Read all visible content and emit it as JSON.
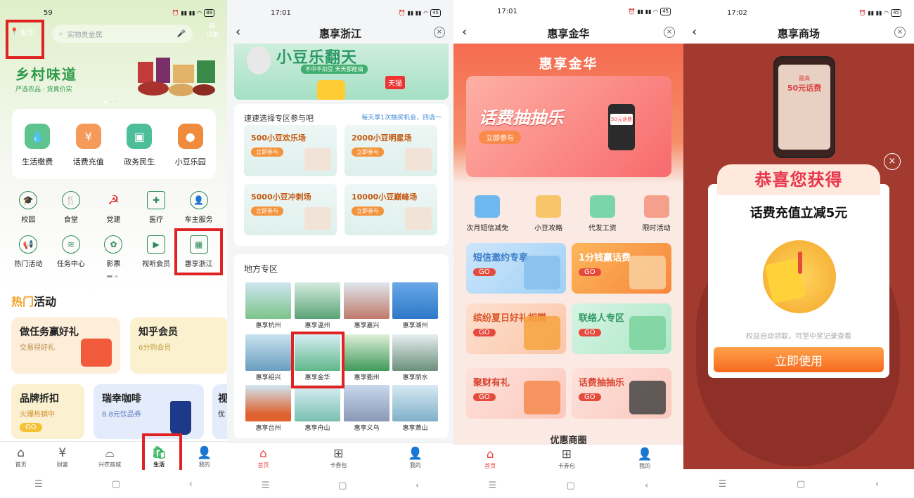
{
  "panel1": {
    "time": "59",
    "battery": "88",
    "location": "金华",
    "search_placeholder": "实物贵金属",
    "orders": "订单",
    "banner_title": "乡村味道",
    "banner_subtitle": "严选农品 · 货真价实",
    "services": [
      "生活缴费",
      "话费充值",
      "政务民生",
      "小豆乐园"
    ],
    "grid": [
      "校园",
      "食堂",
      "党建",
      "医疗",
      "车主服务",
      "热门活动",
      "任务中心",
      "影票",
      "视听会员",
      "惠享浙江"
    ],
    "hot_title_a": "热门",
    "hot_title_b": "活动",
    "cards": [
      {
        "t": "做任务赢好礼",
        "s": "交易得好礼"
      },
      {
        "t": "知乎会员",
        "s": "6分购会员"
      },
      {
        "t": "品牌折扣",
        "s": "火爆热销中",
        "go": "GO"
      },
      {
        "t": "瑞幸咖啡",
        "s": "8.8元饮品券"
      },
      {
        "t": "视",
        "s": "优"
      }
    ],
    "tabs": [
      "首页",
      "财富",
      "兴农商城",
      "生活",
      "我的"
    ]
  },
  "panel2": {
    "time": "17:01",
    "battery": "45",
    "title": "惠享浙江",
    "banner_title": "小豆乐翻天",
    "banner_sub": "不中不扣豆 天天都能抽",
    "banner_tag": "天猫",
    "select_title": "速速选择专区参与吧",
    "select_tip": "每天享1次抽奖机会，四选一",
    "zones": [
      {
        "t": "500小豆欢乐场",
        "b": "立即参与"
      },
      {
        "t": "2000小豆明星场",
        "b": "立即参与"
      },
      {
        "t": "5000小豆冲刺场",
        "b": "立即参与"
      },
      {
        "t": "10000小豆巅峰场",
        "b": "立即参与"
      }
    ],
    "local_title": "地方专区",
    "cities": [
      "惠享杭州",
      "惠享温州",
      "惠享嘉兴",
      "惠享湖州",
      "惠享绍兴",
      "惠享金华",
      "惠享衢州",
      "惠享丽水",
      "惠享台州",
      "惠享舟山",
      "惠享义乌",
      "惠享萧山"
    ],
    "tabs": [
      "首页",
      "卡券包",
      "我的"
    ]
  },
  "panel3": {
    "time": "17:01",
    "battery": "45",
    "title": "惠享金华",
    "header": "惠享金华",
    "card_title": "话费抽抽乐",
    "card_btn": "立即参与",
    "card_phone": "50元话费",
    "icons": [
      "次月短信减免",
      "小豆攻略",
      "代发工资",
      "限时活动"
    ],
    "tiles": [
      {
        "t": "短信邀约专享",
        "g": "GO"
      },
      {
        "t": "1分钱赢话费",
        "g": "GO"
      },
      {
        "t": "缤纷夏日好礼相赠",
        "g": "GO"
      },
      {
        "t": "联络人专区",
        "g": "GO"
      },
      {
        "t": "聚财有礼",
        "g": "GO"
      },
      {
        "t": "话费抽抽乐",
        "g": "GO"
      }
    ],
    "more": "优惠商圈",
    "tabs": [
      "首页",
      "卡券包",
      "我的"
    ]
  },
  "panel4": {
    "time": "17:02",
    "battery": "45",
    "title": "惠享商场",
    "bg_phone_top": "最高",
    "bg_phone_amount": "50元话费",
    "ribbon": "恭喜您获得",
    "prize": "话费充值立减5元",
    "note": "权益自动领取，可至中奖记录查看",
    "use_btn": "立即使用"
  }
}
